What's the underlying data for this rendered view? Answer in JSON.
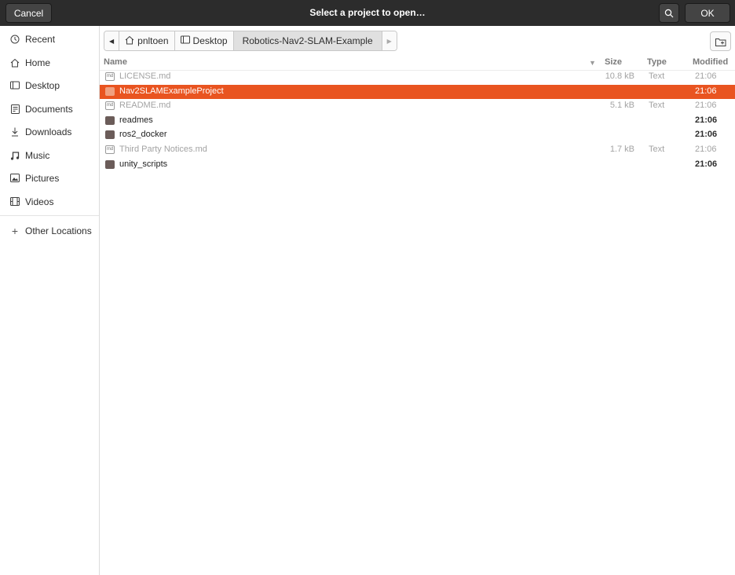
{
  "header": {
    "title": "Select a project to open…",
    "cancel_label": "Cancel",
    "ok_label": "OK",
    "search_icon": "search-icon"
  },
  "sidebar": {
    "items": [
      {
        "label": "Recent",
        "icon": "clock-icon"
      },
      {
        "label": "Home",
        "icon": "home-icon"
      },
      {
        "label": "Desktop",
        "icon": "desktop-icon"
      },
      {
        "label": "Documents",
        "icon": "document-icon"
      },
      {
        "label": "Downloads",
        "icon": "download-icon"
      },
      {
        "label": "Music",
        "icon": "music-icon"
      },
      {
        "label": "Pictures",
        "icon": "picture-icon"
      },
      {
        "label": "Videos",
        "icon": "video-icon"
      }
    ],
    "other_locations": "Other Locations"
  },
  "pathbar": {
    "crumbs": [
      "pnltoen",
      "Desktop",
      "Robotics-Nav2-SLAM-Example"
    ]
  },
  "columns": {
    "name": "Name",
    "size": "Size",
    "type": "Type",
    "modified": "Modified"
  },
  "files": [
    {
      "name": "LICENSE.md",
      "kind": "doc",
      "size": "10.8 kB",
      "type": "Text",
      "modified": "21:06"
    },
    {
      "name": "Nav2SLAMExampleProject",
      "kind": "folder",
      "size": "",
      "type": "",
      "modified": "21:06",
      "selected": true
    },
    {
      "name": "README.md",
      "kind": "doc",
      "size": "5.1 kB",
      "type": "Text",
      "modified": "21:06"
    },
    {
      "name": "readmes",
      "kind": "folder",
      "size": "",
      "type": "",
      "modified": "21:06"
    },
    {
      "name": "ros2_docker",
      "kind": "folder",
      "size": "",
      "type": "",
      "modified": "21:06"
    },
    {
      "name": "Third Party Notices.md",
      "kind": "doc",
      "size": "1.7 kB",
      "type": "Text",
      "modified": "21:06"
    },
    {
      "name": "unity_scripts",
      "kind": "folder",
      "size": "",
      "type": "",
      "modified": "21:06"
    }
  ],
  "colors": {
    "header_bg": "#2c2c2c",
    "selection": "#e95420",
    "folder": "#6b5c59"
  }
}
